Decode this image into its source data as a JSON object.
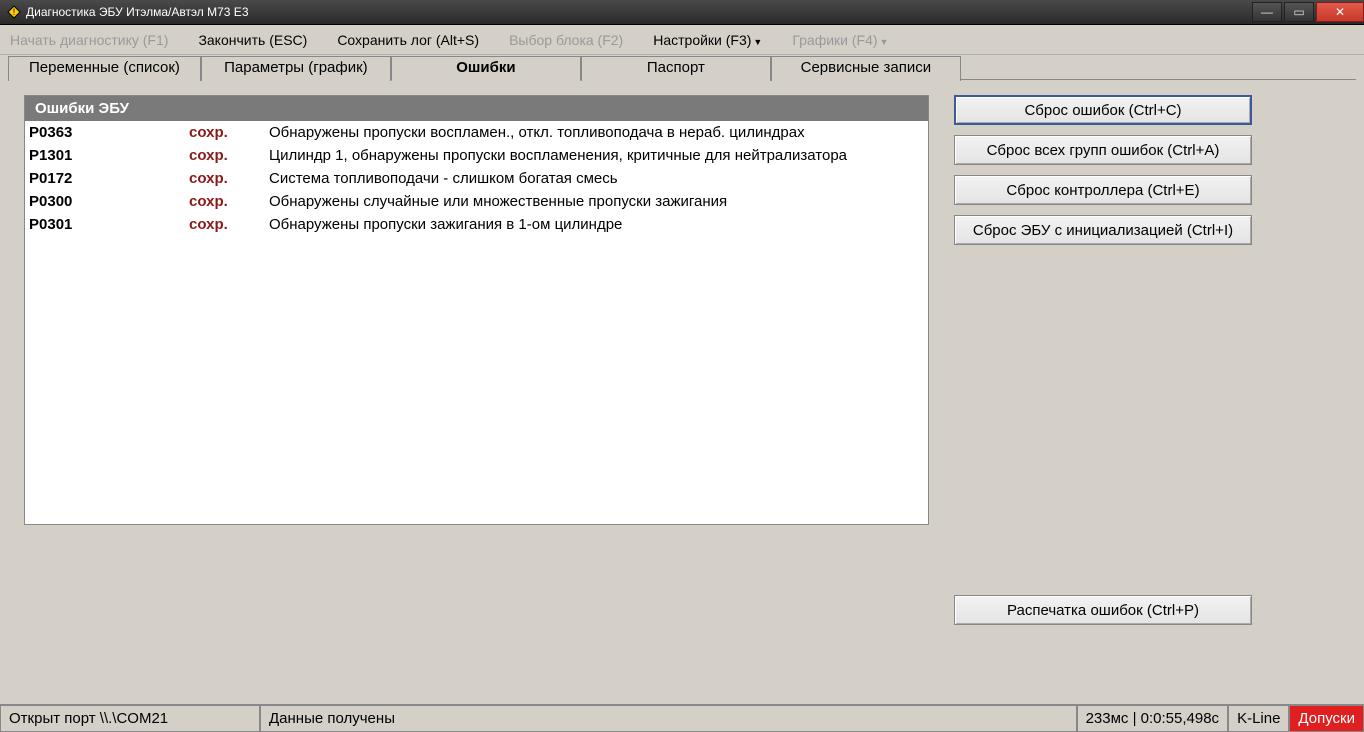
{
  "window": {
    "title": "Диагностика ЭБУ Итэлма/Автэл М73 Е3"
  },
  "menu": {
    "start": "Начать диагностику (F1)",
    "finish": "Закончить (ESC)",
    "savelog": "Сохранить лог (Alt+S)",
    "selectblock": "Выбор блока (F2)",
    "settings": "Настройки (F3)",
    "graphs": "Графики (F4)"
  },
  "tabs": {
    "t0": "Переменные (список)",
    "t1": "Параметры (график)",
    "t2": "Ошибки",
    "t3": "Паспорт",
    "t4": "Сервисные записи"
  },
  "panel": {
    "title": "Ошибки ЭБУ",
    "status_label": "сохр.",
    "rows": [
      {
        "code": "P0363",
        "desc": "Обнаружены пропуски воспламен., откл. топливоподача в нераб. цилиндрах"
      },
      {
        "code": "P1301",
        "desc": "Цилиндр 1, обнаружены пропуски воспламенения, критичные для нейтрализатора"
      },
      {
        "code": "P0172",
        "desc": "Система топливоподачи - слишком богатая  смесь"
      },
      {
        "code": "P0300",
        "desc": "Обнаружены случайные или множественные пропуски зажигания"
      },
      {
        "code": "P0301",
        "desc": "Обнаружены пропуски зажигания в 1-ом цилиндре"
      }
    ]
  },
  "buttons": {
    "reset_errors": "Сброс ошибок (Ctrl+C)",
    "reset_all_groups": "Сброс всех групп ошибок (Ctrl+A)",
    "reset_controller": "Сброс контроллера (Ctrl+E)",
    "reset_ecu_init": "Сброс ЭБУ с инициализацией (Ctrl+I)",
    "print_errors": "Распечатка ошибок (Ctrl+P)"
  },
  "status": {
    "port": "Открыт порт \\\\.\\COM21",
    "message": "Данные получены",
    "timing": "233мс | 0:0:55,498с",
    "kline": "K-Line",
    "tolerances": "Допуски"
  }
}
